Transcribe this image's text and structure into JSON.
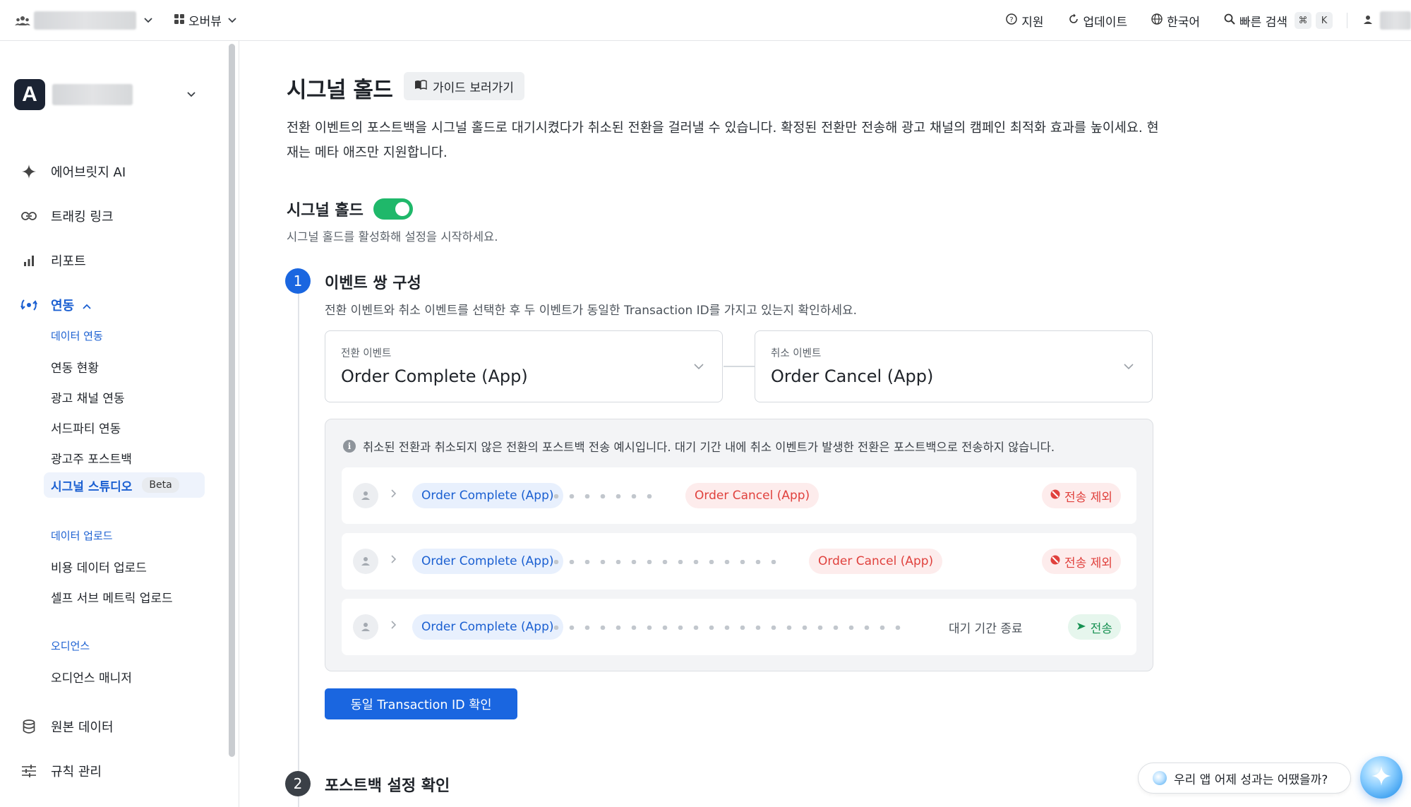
{
  "topbar": {
    "nav_label": "오버뷰",
    "support": "지원",
    "updates": "업데이트",
    "language": "한국어",
    "quick_search": "빠른 검색",
    "shortcut_cmd": "⌘",
    "shortcut_key": "K"
  },
  "sidebar": {
    "ai": "에어브릿지 AI",
    "tracking_link": "트래킹 링크",
    "report": "리포트",
    "integration": "연동",
    "data_integration_header": "데이터 연동",
    "integration_status": "연동 현황",
    "ad_channel_integration": "광고 채널 연동",
    "third_party_integration": "서드파티 연동",
    "advertiser_postback": "광고주 포스트백",
    "signal_studio": "시그널 스튜디오",
    "beta_badge": "Beta",
    "data_upload_header": "데이터 업로드",
    "cost_data_upload": "비용 데이터 업로드",
    "self_serve_metric_upload": "셀프 서브 메트릭 업로드",
    "audience_header": "오디언스",
    "audience_manager": "오디언스 매니저",
    "raw_data": "원본 데이터",
    "rule_management": "규칙 관리"
  },
  "main": {
    "title": "시그널 홀드",
    "guide_button": "가이드 보러가기",
    "description": "전환 이벤트의 포스트백을 시그널 홀드로 대기시켰다가 취소된 전환을 걸러낼 수 있습니다. 확정된 전환만 전송해 광고 채널의 캠페인 최적화 효과를 높이세요. 현재는 메타 애즈만 지원합니다.",
    "signal_hold_label": "시그널 홀드",
    "signal_hold_enabled": true,
    "signal_hold_sub": "시그널 홀드를 활성화해 설정을 시작하세요.",
    "step1": {
      "number": "1",
      "title": "이벤트 쌍 구성",
      "description": "전환 이벤트와 취소 이벤트를 선택한 후 두 이벤트가 동일한 Transaction ID를 가지고 있는지 확인하세요.",
      "conversion_label": "전환 이벤트",
      "conversion_value": "Order Complete (App)",
      "cancel_label": "취소 이벤트",
      "cancel_value": "Order Cancel (App)",
      "note": "취소된 전환과 취소되지 않은 전환의 포스트백 전송 예시입니다. 대기 기간 내에 취소 이벤트가 발생한 전환은 포스트백으로 전송하지 않습니다.",
      "rows": [
        {
          "conversion": "Order Complete (App)",
          "cancel": "Order Cancel (App)",
          "status": "전송 제외"
        },
        {
          "conversion": "Order Complete (App)",
          "cancel": "Order Cancel (App)",
          "status": "전송 제외"
        },
        {
          "conversion": "Order Complete (App)",
          "wait_text": "대기 기간 종료",
          "status": "전송"
        }
      ],
      "confirm_button": "동일 Transaction ID 확인"
    },
    "step2": {
      "number": "2",
      "title": "포스트백 설정 확인"
    }
  },
  "chat": {
    "prompt": "우리 앱 어제 성과는 어땠을까?"
  },
  "colors": {
    "primary": "#1a66e0",
    "toggle_on": "#1fb86a",
    "excluded": "#e0413d",
    "sent": "#179152"
  },
  "icons": {
    "workspace": "team-icon",
    "overview": "grid-icon",
    "support": "question-circle-icon",
    "updates": "refresh-icon",
    "language": "globe-icon",
    "search": "search-icon",
    "user": "user-icon",
    "ai": "sparkle-icon",
    "tracking_link": "link-icon",
    "report": "bar-chart-icon",
    "integration": "sync-icon",
    "raw_data": "database-icon",
    "rules": "sliders-icon",
    "guide": "book-icon",
    "info": "info-icon",
    "excluded": "block-icon",
    "sent": "send-icon"
  }
}
